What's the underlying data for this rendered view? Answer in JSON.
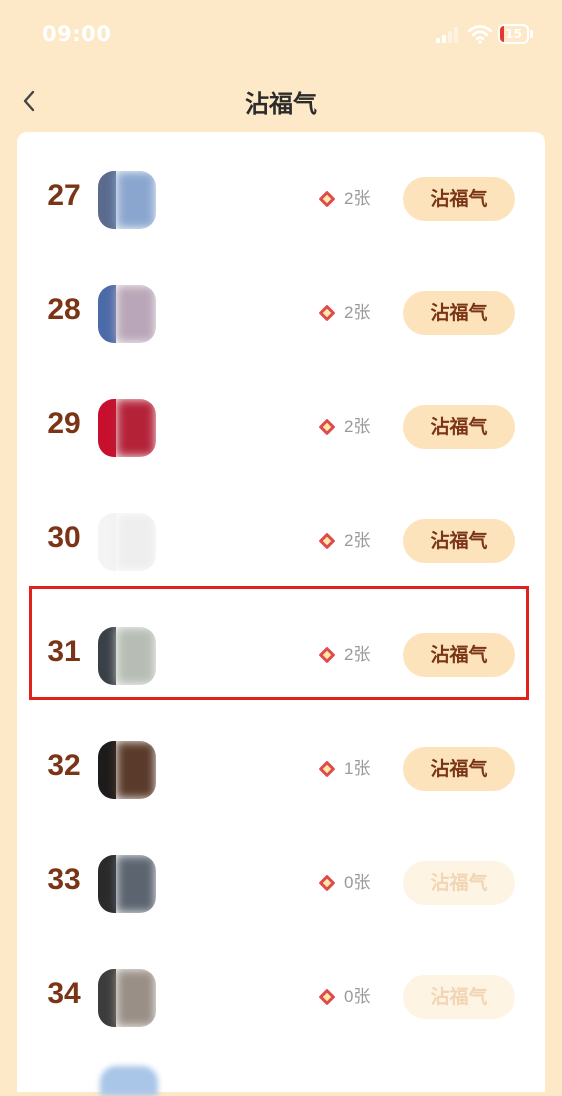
{
  "status_bar": {
    "time": "09:00",
    "battery": "15",
    "battery_level": 0.15,
    "battery_color": "#e5392d"
  },
  "header": {
    "title": "沾福气",
    "back_icon": "chevron-left-icon"
  },
  "colors": {
    "background": "#fde9c7",
    "rank_text": "#7a3416",
    "button_bg": "#fde3bb",
    "button_disabled_bg": "#fef4e3",
    "highlight_border": "#e0211c",
    "fu_icon": "#e04a4a"
  },
  "list": {
    "button_label": "沾福气",
    "count_unit": "张",
    "fu_icon": "fu-card-icon",
    "highlighted_rank": "31",
    "rows": [
      {
        "rank": "27",
        "count": "2张",
        "enabled": true,
        "avatar_left": "#5a6b8e",
        "avatar_right": "#8aa6cf"
      },
      {
        "rank": "28",
        "count": "2张",
        "enabled": true,
        "avatar_left": "#4a6aa8",
        "avatar_right": "#b9a6b8"
      },
      {
        "rank": "29",
        "count": "2张",
        "enabled": true,
        "avatar_left": "#c8102e",
        "avatar_right": "#b42238"
      },
      {
        "rank": "30",
        "count": "2张",
        "enabled": true,
        "avatar_left": "#f4f4f4",
        "avatar_right": "#eeeeee"
      },
      {
        "rank": "31",
        "count": "2张",
        "enabled": true,
        "avatar_left": "#3a4048",
        "avatar_right": "#b7bdb4"
      },
      {
        "rank": "32",
        "count": "1张",
        "enabled": true,
        "avatar_left": "#1c1c1c",
        "avatar_right": "#5a3a2a"
      },
      {
        "rank": "33",
        "count": "0张",
        "enabled": false,
        "avatar_left": "#2a2a2a",
        "avatar_right": "#5c6470"
      },
      {
        "rank": "34",
        "count": "0张",
        "enabled": false,
        "avatar_left": "#3c3c3c",
        "avatar_right": "#9a8f86"
      }
    ]
  }
}
